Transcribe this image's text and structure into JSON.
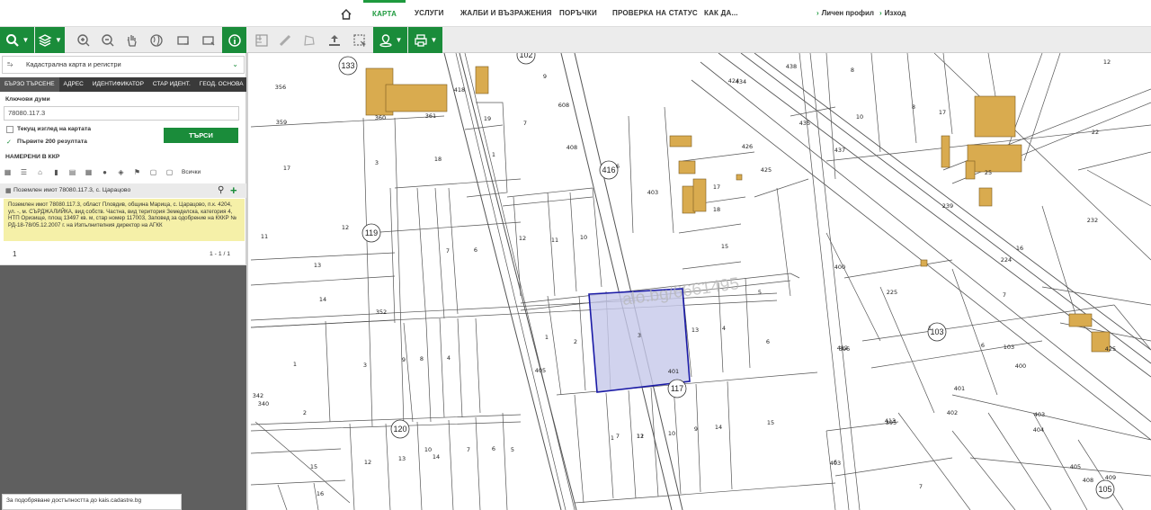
{
  "nav": {
    "tabs": [
      "КАРТА",
      "УСЛУГИ",
      "ЖАЛБИ И ВЪЗРАЖЕНИЯ",
      "ПОРЪЧКИ",
      "ПРОВЕРКА НА СТАТУС",
      "КАК ДА..."
    ],
    "profile": "Личен профил",
    "logout": "Изход"
  },
  "panel": {
    "layer_select": "Кадастрална карта и регистри",
    "tabs": [
      "БЪРЗО ТЪРСЕНЕ",
      "АДРЕС",
      "ИДЕНТИФИКАТОР",
      "СТАР ИДЕНТ.",
      "ГЕОД. ОСНОВА"
    ],
    "keywords_label": "Ключови думи",
    "keywords_value": "78080.117.3",
    "current_view_label": "Текущ изглед на картата",
    "first_200_label": "Първите 200 резултата",
    "search_button": "ТЪРСИ",
    "found_label": "НАМЕРЕНИ В ККР",
    "all_label": "Всички",
    "result_title": "Поземлен имот 78080.117.3, с. Царацово",
    "result_details": "Поземлен имот 78080.117.3, област Пловдив, община Марица, с. Царацово, п.к. 4204, ул. -, м. СЪРДЖАЛИЙКА, вид собств. Частна, вид територия Земеделска, категория 4, НТП Оризище, площ 13497 кв. м, стар номер 117003, Заповед за одобрение на КККР № РД-18-78/05.12.2007 г. на Изпълнителния директор на АГКК",
    "pager_page": "1",
    "pager_range": "1 - 1 / 1",
    "access_note": "За подобряване достъпността до kais.cadastre.bg"
  },
  "map": {
    "watermark": "alo.bg/6661495",
    "block_labels": [
      "133",
      "102",
      "416",
      "119",
      "103",
      "120",
      "117",
      "105"
    ],
    "parcel_labels": [
      "356",
      "359",
      "360",
      "361",
      "17",
      "3",
      "18",
      "11",
      "12",
      "13",
      "14",
      "352",
      "1",
      "3",
      "2",
      "9",
      "8",
      "7",
      "6",
      "4",
      "10",
      "15",
      "16",
      "12",
      "13",
      "14",
      "7",
      "6",
      "5",
      "342",
      "340",
      "418",
      "19",
      "7",
      "1",
      "9",
      "608",
      "408",
      "6",
      "403",
      "405",
      "18",
      "17",
      "12",
      "11",
      "10",
      "15",
      "5",
      "1",
      "2",
      "3",
      "13",
      "4",
      "6",
      "401",
      "1",
      "12",
      "11",
      "10",
      "9",
      "14",
      "15",
      "7",
      "403",
      "425",
      "426",
      "424",
      "434",
      "435",
      "437",
      "438",
      "8",
      "10",
      "8",
      "17",
      "12",
      "22",
      "25",
      "239",
      "232",
      "16",
      "224",
      "225",
      "400",
      "396",
      "395",
      "7",
      "1",
      "6",
      "103",
      "400",
      "401",
      "402",
      "403",
      "404",
      "405",
      "408",
      "409",
      "412",
      "413",
      "7",
      "6",
      "425",
      "423",
      "226",
      "85"
    ]
  },
  "colors": {
    "brand_green": "#1a8c3a",
    "nav_active": "#1e9a3e",
    "selected_parcel_fill": "#c5c8ea",
    "selected_parcel_stroke": "#1a1aa6",
    "building_fill": "#d9ab4f",
    "result_highlight": "#f5f0a8"
  }
}
